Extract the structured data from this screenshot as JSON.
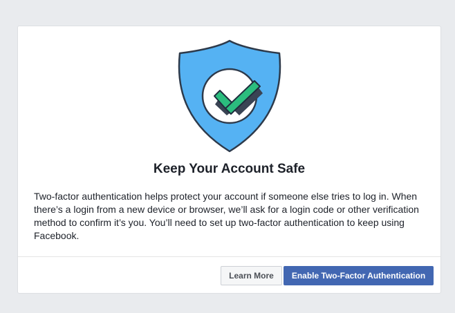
{
  "dialog": {
    "title": "Keep Your Account Safe",
    "description": "Two-factor authentication helps protect your account if someone else tries to log in. When there’s a login from a new device or browser, we’ll ask for a login code or other verification method to confirm it’s you. You’ll need to set up two-factor authentication to keep using Facebook.",
    "illustration_icon": "shield-check-icon"
  },
  "actions": {
    "learn_more_label": "Learn More",
    "enable_label": "Enable Two-Factor Authentication"
  },
  "colors": {
    "background": "#e9ebee",
    "shield_blue": "#55b2f3",
    "check_green": "#2bbd7e",
    "primary_button": "#4267b2",
    "text": "#1d2129"
  }
}
